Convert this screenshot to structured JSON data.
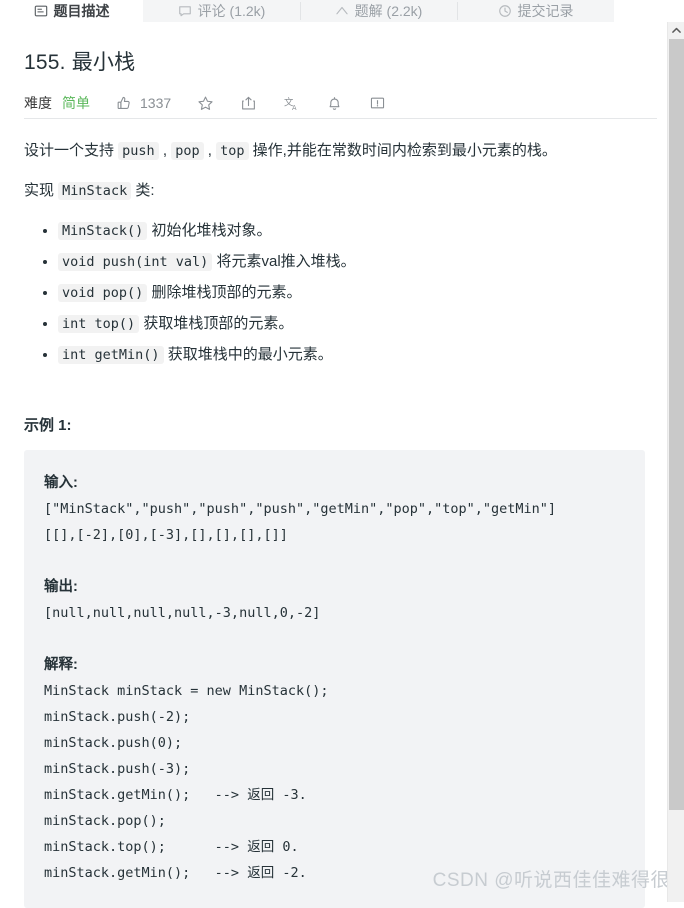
{
  "tabs": [
    {
      "label": "题目描述",
      "icon": "description-icon",
      "active": true
    },
    {
      "label": "评论 (1.2k)",
      "icon": "comment-icon",
      "active": false
    },
    {
      "label": "题解 (2.2k)",
      "icon": "solution-icon",
      "active": false
    },
    {
      "label": "提交记录",
      "icon": "history-icon",
      "active": false
    }
  ],
  "problem": {
    "title": "155. 最小栈",
    "difficulty_label": "难度",
    "difficulty_value": "简单",
    "difficulty_color": "#5cb85c",
    "likes": "1337"
  },
  "actions": {
    "like": "thumbs-up-icon",
    "star": "star-icon",
    "share": "share-icon",
    "translate": "translate-icon",
    "notify": "bell-icon",
    "feedback": "feedback-icon"
  },
  "description": {
    "line1_a": "设计一个支持 ",
    "line1_push": "push",
    "line1_b": " , ",
    "line1_pop": "pop",
    "line1_c": " , ",
    "line1_top": "top",
    "line1_d": " 操作,并能在常数时间内检索到最小元素的栈。",
    "line2_a": "实现 ",
    "line2_code": "MinStack",
    "line2_b": " 类:"
  },
  "api_list": [
    {
      "code": "MinStack()",
      "text": " 初始化堆栈对象。"
    },
    {
      "code": "void push(int val)",
      "text": " 将元素val推入堆栈。"
    },
    {
      "code": "void pop()",
      "text": " 删除堆栈顶部的元素。"
    },
    {
      "code": "int top()",
      "text": " 获取堆栈顶部的元素。"
    },
    {
      "code": "int getMin()",
      "text": " 获取堆栈中的最小元素。"
    }
  ],
  "example": {
    "title": "示例 1:",
    "input_label": "输入:",
    "input_lines": [
      "[\"MinStack\",\"push\",\"push\",\"push\",\"getMin\",\"pop\",\"top\",\"getMin\"]",
      "[[],[-2],[0],[-3],[],[],[],[]]"
    ],
    "output_label": "输出:",
    "output_lines": [
      "[null,null,null,null,-3,null,0,-2]"
    ],
    "explain_label": "解释:",
    "explain_lines": [
      "MinStack minStack = new MinStack();",
      "minStack.push(-2);",
      "minStack.push(0);",
      "minStack.push(-3);",
      "minStack.getMin();   --> 返回 -3.",
      "minStack.pop();",
      "minStack.top();      --> 返回 0.",
      "minStack.getMin();   --> 返回 -2."
    ]
  },
  "watermark": "CSDN @听说西佳佳难得很"
}
